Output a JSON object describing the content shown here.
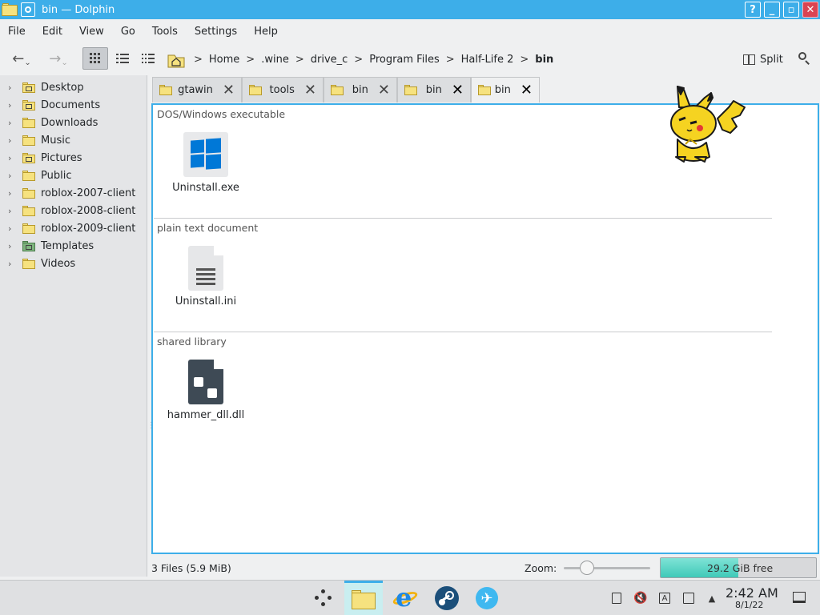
{
  "window": {
    "title": "bin — Dolphin",
    "controls": [
      "?",
      "_",
      "▫",
      "✕"
    ]
  },
  "menu": [
    "File",
    "Edit",
    "View",
    "Go",
    "Tools",
    "Settings",
    "Help"
  ],
  "toolbar": {
    "breadcrumbs": [
      "Home",
      ".wine",
      "drive_c",
      "Program Files",
      "Half-Life 2",
      "bin"
    ],
    "split_label": "Split",
    "view_mode": "icons"
  },
  "sidebar": {
    "items": [
      {
        "label": "Desktop",
        "icon": "desktop-folder-icon"
      },
      {
        "label": "Documents",
        "icon": "documents-folder-icon"
      },
      {
        "label": "Downloads",
        "icon": "folder-icon"
      },
      {
        "label": "Music",
        "icon": "folder-icon"
      },
      {
        "label": "Pictures",
        "icon": "pictures-folder-icon"
      },
      {
        "label": "Public",
        "icon": "folder-icon"
      },
      {
        "label": "roblox-2007-client",
        "icon": "folder-icon"
      },
      {
        "label": "roblox-2008-client",
        "icon": "folder-icon"
      },
      {
        "label": "roblox-2009-client",
        "icon": "folder-icon"
      },
      {
        "label": "Templates",
        "icon": "templates-folder-icon"
      },
      {
        "label": "Videos",
        "icon": "folder-icon"
      }
    ]
  },
  "tabs": [
    {
      "label": "gtawin",
      "active": false
    },
    {
      "label": "tools",
      "active": false
    },
    {
      "label": "bin",
      "active": false
    },
    {
      "label": "bin",
      "active": false
    },
    {
      "label": "bin",
      "active": true
    }
  ],
  "groups": [
    {
      "label": "DOS/Windows executable",
      "files": [
        {
          "name": "Uninstall.exe",
          "icon": "windows-executable-icon"
        }
      ]
    },
    {
      "label": "plain text document",
      "files": [
        {
          "name": "Uninstall.ini",
          "icon": "text-document-icon"
        }
      ]
    },
    {
      "label": "shared library",
      "files": [
        {
          "name": "hammer_dll.dll",
          "icon": "shared-library-icon"
        }
      ]
    }
  ],
  "status": {
    "summary": "3 Files (5.9 MiB)",
    "zoom_label": "Zoom:",
    "zoom_level": 0.2,
    "free_space": "29.2 GiB free",
    "used_fraction": 0.5
  },
  "taskbar": {
    "clock_time": "2:42 AM",
    "clock_date": "8/1/22"
  },
  "colors": {
    "accent": "#3daee9",
    "folder": "#f6e27f",
    "windows_blue": "#0078d7"
  }
}
